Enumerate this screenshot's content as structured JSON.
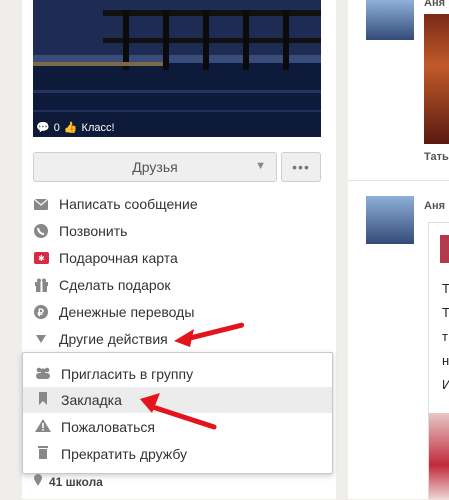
{
  "photo": {
    "comments": "0",
    "like_label": "Класс!"
  },
  "friends_button": {
    "label": "Друзья"
  },
  "actions": [
    {
      "label": "Написать сообщение",
      "icon": "envelope-icon"
    },
    {
      "label": "Позвонить",
      "icon": "phone-icon"
    },
    {
      "label": "Подарочная карта",
      "icon": "gift-card-icon"
    },
    {
      "label": "Сделать подарок",
      "icon": "gift-icon"
    },
    {
      "label": "Денежные переводы",
      "icon": "ruble-icon"
    },
    {
      "label": "Другие действия",
      "icon": "triangle-down-icon"
    }
  ],
  "dropdown": [
    {
      "label": "Пригласить в группу",
      "icon": "group-icon"
    },
    {
      "label": "Закладка",
      "icon": "bookmark-icon"
    },
    {
      "label": "Пожаловаться",
      "icon": "warning-icon"
    },
    {
      "label": "Прекратить дружбу",
      "icon": "trash-icon"
    }
  ],
  "school": {
    "label": "41 школа"
  },
  "feed": {
    "author_1": "Аня",
    "author_1_sub": "Тать",
    "author_2": "Аня",
    "snippet_letters": [
      "Т",
      "Т",
      "т",
      "н",
      "И"
    ]
  },
  "colors": {
    "arrow": "#e3141b",
    "accent": "#ee8208"
  }
}
